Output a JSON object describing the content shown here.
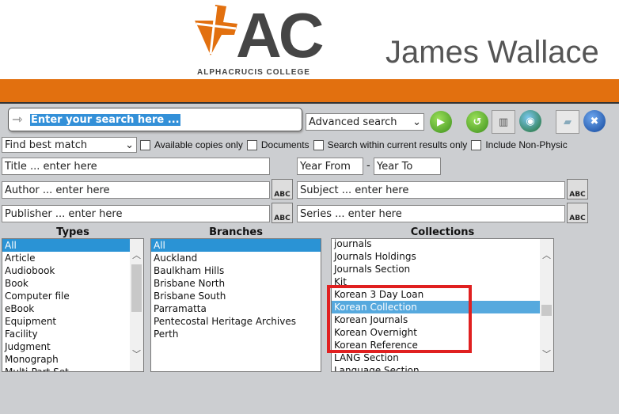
{
  "header": {
    "logo_text": "AC",
    "logo_subtitle": "ALPHACRUCIS COLLEGE",
    "library_title": "James Wallace"
  },
  "colors": {
    "brand_orange": "#e2700f",
    "selection": "#2a93d5",
    "highlight_box": "#e02020"
  },
  "search": {
    "placeholder": "Enter your search here ...",
    "mode": "Advanced search",
    "match": "Find best match",
    "buttons": [
      "go-icon",
      "reset-icon",
      "clear-icon",
      "globe-search-icon",
      "eraser-icon",
      "close-icon"
    ]
  },
  "options": [
    "Available copies only",
    "Documents",
    "Search within current results only",
    "Include Non-Physic"
  ],
  "fields": {
    "title": "Title ... enter here",
    "year_from": "Year From",
    "dash": "-",
    "year_to": "Year To",
    "author": "Author ... enter here",
    "subject": "Subject ... enter here",
    "publisher": "Publisher ... enter here",
    "series": "Series ... enter here",
    "abc": "ABC"
  },
  "types": {
    "label": "Types",
    "items": [
      "All",
      "Article",
      "Audiobook",
      "Book",
      "Computer file",
      "eBook",
      "Equipment",
      "Facility",
      "Judgment",
      "Monograph",
      "Multi-Part Set"
    ],
    "selected": "All"
  },
  "branches": {
    "label": "Branches",
    "items": [
      "All",
      "Auckland",
      "Baulkham Hills",
      "Brisbane North",
      "Brisbane South",
      "Parramatta",
      "Pentecostal Heritage Archives",
      "Perth"
    ],
    "selected": "All"
  },
  "collections": {
    "label": "Collections",
    "items": [
      "journals",
      "Journals Holdings",
      "Journals Section",
      "Kit",
      "Korean 3 Day Loan",
      "Korean Collection",
      "Korean Journals",
      "Korean Overnight",
      "Korean Reference",
      "LANG Section",
      "Language Section"
    ],
    "selected": "Korean Collection"
  }
}
